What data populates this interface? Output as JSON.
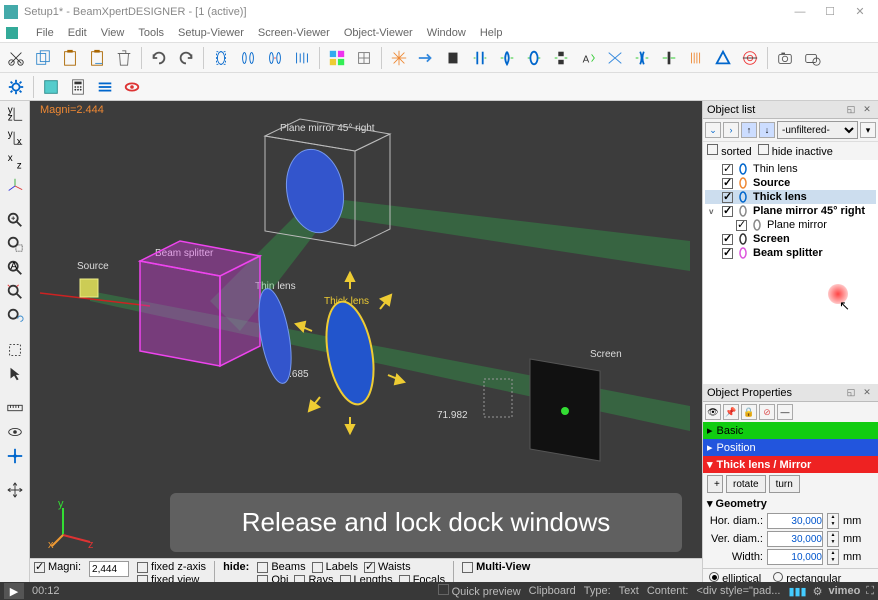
{
  "title": "Setup1* - BeamXpertDESIGNER  - [1 (active)]",
  "menu": [
    "File",
    "Edit",
    "View",
    "Tools",
    "Setup-Viewer",
    "Screen-Viewer",
    "Object-Viewer",
    "Window",
    "Help"
  ],
  "magni_label": "Magni=2.444",
  "scene": {
    "labels": {
      "plane_mirror": "Plane mirror 45° right",
      "source": "Source",
      "beam_splitter": "Beam splitter",
      "thin_lens": "Thin lens",
      "thick_lens": "Thick lens",
      "screen": "Screen",
      "val1": "23.685",
      "val2": "71.982"
    },
    "axes": {
      "x": "x",
      "y": "y",
      "z": "z"
    }
  },
  "banner": "Release and lock dock windows",
  "bottombar": {
    "magni": "Magni:",
    "magni_val": "2,444",
    "fixed_z": "fixed z-axis",
    "fixed_view": "fixed view",
    "hide": "hide:",
    "opts1": [
      "Beams",
      "Labels",
      "Waists"
    ],
    "opts2": [
      "Obj",
      "Rays",
      "Lengths",
      "Focals"
    ],
    "multiview": "Multi-View"
  },
  "objectlist": {
    "title": "Object list",
    "filter": "-unfiltered-",
    "sorted": "sorted",
    "hide_inactive": "hide inactive",
    "items": [
      {
        "label": "Thin lens",
        "bold": false,
        "indent": 0,
        "icon": "lens"
      },
      {
        "label": "Source",
        "bold": true,
        "indent": 0,
        "icon": "source"
      },
      {
        "label": "Thick lens",
        "bold": true,
        "indent": 0,
        "icon": "lens",
        "sel": true
      },
      {
        "label": "Plane mirror 45° right",
        "bold": true,
        "indent": 0,
        "icon": "mirror",
        "exp": "v"
      },
      {
        "label": "Plane mirror",
        "bold": false,
        "indent": 1,
        "icon": "mirror"
      },
      {
        "label": "Screen",
        "bold": true,
        "indent": 0,
        "icon": "screen"
      },
      {
        "label": "Beam splitter",
        "bold": true,
        "indent": 0,
        "icon": "splitter"
      }
    ]
  },
  "props": {
    "title": "Object Properties",
    "basic": "Basic",
    "position": "Position",
    "thick": "Thick lens / Mirror",
    "rotate": "rotate",
    "turn": "turn",
    "geometry": "Geometry",
    "hor_diam": "Hor. diam.:",
    "ver_diam": "Ver. diam.:",
    "width": "Width:",
    "val_hor": "30,000",
    "val_ver": "30,000",
    "val_width": "10,000",
    "unit": "mm",
    "elliptical": "elliptical",
    "rectangular": "rectangular"
  },
  "status": {
    "time": "00:12",
    "quick": "Quick preview",
    "clip": "Clipboard",
    "type": "Type:",
    "text": "Text",
    "content": "Content:",
    "content_val": "<div style=\"pad...",
    "vimeo": "vimeo"
  }
}
